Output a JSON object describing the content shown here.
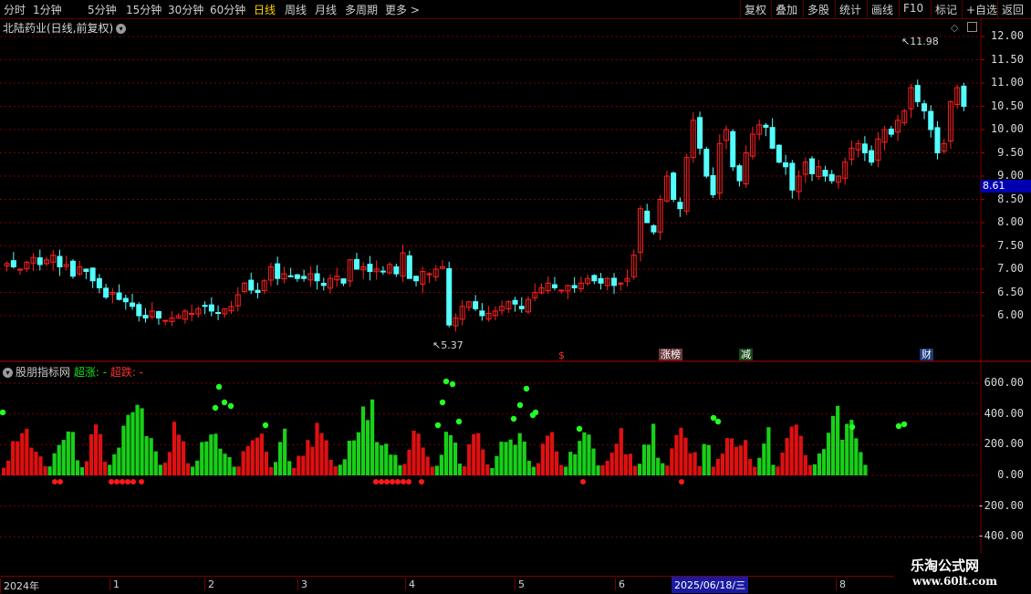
{
  "toolbar": {
    "periods": [
      "分时",
      "1分钟",
      "5分钟",
      "15分钟",
      "30分钟",
      "60分钟",
      "日线",
      "周线",
      "月线",
      "多周期",
      "更多 >"
    ],
    "active": "日线",
    "right_buttons": [
      "复权",
      "叠加",
      "多股",
      "统计",
      "画线",
      "F10",
      "标记",
      "+自选",
      "返回"
    ]
  },
  "main_chart": {
    "title": "北陆药业(日线,前复权)",
    "menu_icon": "chevron-down-icon",
    "price_axis": [
      "12.00",
      "11.50",
      "11.00",
      "10.50",
      "10.00",
      "9.50",
      "9.00",
      "8.50",
      "8.00",
      "7.50",
      "7.00",
      "6.50",
      "6.00"
    ],
    "current_price": "8.61",
    "high_label": "11.98",
    "low_label": "5.37",
    "annotations": [
      "$",
      "涨榜",
      "减",
      "财"
    ],
    "colors": {
      "up": "#ff2020",
      "down": "#54ffff",
      "grid": "#7a0000"
    }
  },
  "indicator": {
    "title": "股朋指标网",
    "label_up": "超涨: -",
    "label_down": "超跌: -",
    "axis": [
      "600.00",
      "400.00",
      "200.00",
      "0.00",
      "-200.00",
      "-400.00"
    ]
  },
  "date_axis": {
    "labels": [
      "2024年",
      "1",
      "2",
      "3",
      "4",
      "5",
      "6",
      "8"
    ],
    "highlight": "2025/06/18/三"
  },
  "watermark": {
    "line1": "乐淘公式网",
    "line2": "www.60lt.com"
  },
  "chart_data": {
    "type": "candlestick",
    "ylim": [
      5.0,
      12.4
    ],
    "indicator_ylim": [
      -400,
      600
    ],
    "closes": [
      7.12,
      7.05,
      7.0,
      7.15,
      7.25,
      7.1,
      7.2,
      7.3,
      7.05,
      7.1,
      6.85,
      7.05,
      6.95,
      6.75,
      6.6,
      6.4,
      6.5,
      6.35,
      6.3,
      6.2,
      6.0,
      5.95,
      6.1,
      5.95,
      5.9,
      5.95,
      6.0,
      6.1,
      6.05,
      6.15,
      6.2,
      6.1,
      6.05,
      6.15,
      6.2,
      6.45,
      6.7,
      6.55,
      6.5,
      6.75,
      7.05,
      6.8,
      6.9,
      6.85,
      6.8,
      6.8,
      6.9,
      6.75,
      6.65,
      6.8,
      6.85,
      6.7,
      7.2,
      7.0,
      7.05,
      6.95,
      7.0,
      6.95,
      7.1,
      6.9,
      7.35,
      6.8,
      6.75,
      6.95,
      6.9,
      7.0,
      7.05,
      5.8,
      5.95,
      6.2,
      6.3,
      6.15,
      6.0,
      6.05,
      6.1,
      6.2,
      6.3,
      6.25,
      6.15,
      6.35,
      6.5,
      6.6,
      6.7,
      6.6,
      6.55,
      6.65,
      6.6,
      6.7,
      6.8,
      6.75,
      6.7,
      6.8,
      6.65,
      6.7,
      6.8,
      7.3,
      8.3,
      8.0,
      7.8,
      8.5,
      9.0,
      8.5,
      8.3,
      9.4,
      10.2,
      9.6,
      9.0,
      8.6,
      9.7,
      10.0,
      9.2,
      8.9,
      9.5,
      9.9,
      10.1,
      10.05,
      9.6,
      9.3,
      9.2,
      8.7,
      9.0,
      9.3,
      9.05,
      9.2,
      9.0,
      8.9,
      9.0,
      9.3,
      9.6,
      9.7,
      9.5,
      9.3,
      9.8,
      10.0,
      9.9,
      10.2,
      10.4,
      10.9,
      10.6,
      10.4,
      10.0,
      9.5,
      9.7,
      10.6,
      10.9,
      10.5
    ]
  }
}
